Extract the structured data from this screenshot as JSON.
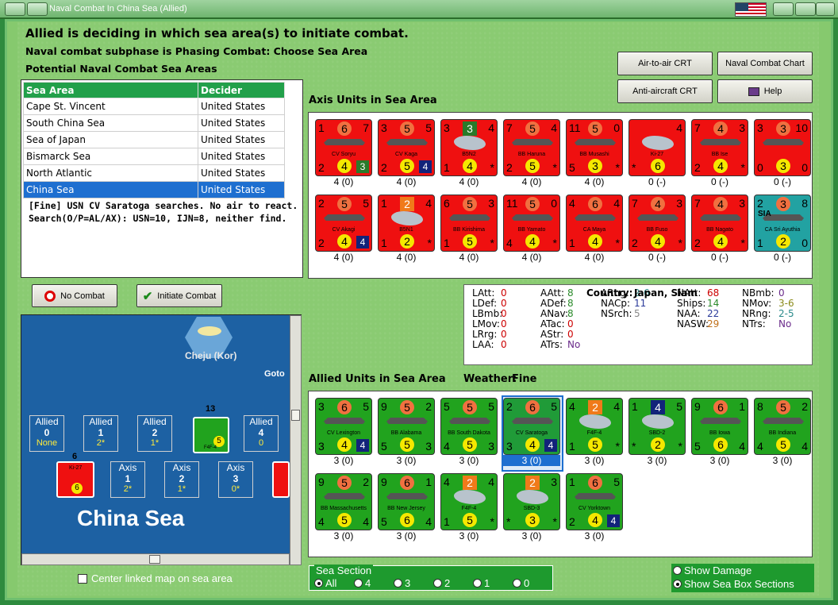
{
  "window": {
    "title": "Naval Combat In China Sea (Allied)"
  },
  "header": {
    "line1": "Allied is deciding in which sea area(s) to initiate combat.",
    "line2": "Naval combat subphase is Phasing Combat: Choose Sea Area",
    "line3": "Potential Naval Combat Sea Areas"
  },
  "buttons": {
    "air_to_air": "Air-to-air CRT",
    "naval_chart": "Naval Combat Chart",
    "anti_aircraft": "Anti-aircraft CRT",
    "help": "Help",
    "no_combat": "No Combat",
    "initiate": "Initiate Combat"
  },
  "sea_table": {
    "headers": [
      "Sea Area",
      "Decider"
    ],
    "rows": [
      [
        "Cape St. Vincent",
        "United States"
      ],
      [
        "South China Sea",
        "United States"
      ],
      [
        "Sea of Japan",
        "United States"
      ],
      [
        "Bismarck Sea",
        "United States"
      ],
      [
        "North Atlantic",
        "United States"
      ],
      [
        "China Sea",
        "United States"
      ]
    ],
    "selected": 5
  },
  "log": "[Fine]  USN CV Saratoga searches.  No air to react.  Search(O/P=AL/AX):  USN=10, IJN=8, neither find.",
  "axis": {
    "title": "Axis Units in Sea Area",
    "units": [
      {
        "tl": "1",
        "tc": "6",
        "tr": "7",
        "name": "CV Soryu",
        "bl": "2",
        "bc": "4",
        "br": "3",
        "cap": "4 (0)",
        "kind": "ship",
        "brstyle": "g"
      },
      {
        "tl": "3",
        "tc": "5",
        "tr": "5",
        "name": "CV Kaga",
        "bl": "2",
        "bc": "5",
        "br": "4",
        "cap": "4 (0)",
        "kind": "ship",
        "brstyle": "b"
      },
      {
        "tl": "3",
        "tc": "3",
        "tr": "4",
        "name": "B5N2",
        "bl": "1",
        "bc": "4",
        "br": "*",
        "cap": "4 (0)",
        "kind": "plane",
        "tcstyle": "g"
      },
      {
        "tl": "7",
        "tc": "5",
        "tr": "4",
        "name": "BB Haruna",
        "bl": "2",
        "bc": "5",
        "br": "*",
        "cap": "4 (0)",
        "kind": "ship"
      },
      {
        "tl": "11",
        "tc": "5",
        "tr": "0",
        "name": "BB Musashi",
        "bl": "5",
        "bc": "3",
        "br": "*",
        "cap": "4 (0)",
        "kind": "ship"
      },
      {
        "tl": "",
        "tc": "",
        "tr": "4",
        "name": "Ki-27",
        "bl": "*",
        "bc": "6",
        "br": "",
        "cap": "0 (-)",
        "kind": "plane"
      },
      {
        "tl": "7",
        "tc": "4",
        "tr": "3",
        "name": "BB Ise",
        "bl": "2",
        "bc": "4",
        "br": "*",
        "cap": "0 (-)",
        "kind": "ship"
      },
      {
        "tl": "3",
        "tc": "3",
        "tr": "10",
        "name": "",
        "bl": "0",
        "bc": "3",
        "br": "0",
        "cap": "0 (-)",
        "kind": "ship"
      },
      {
        "tl": "2",
        "tc": "5",
        "tr": "5",
        "name": "CV Akagi",
        "bl": "2",
        "bc": "4",
        "br": "4",
        "cap": "4 (0)",
        "kind": "ship",
        "brstyle": "b"
      },
      {
        "tl": "1",
        "tc": "2",
        "tr": "4",
        "name": "B5N1",
        "bl": "1",
        "bc": "2",
        "br": "*",
        "cap": "4 (0)",
        "kind": "plane",
        "tcstyle": "o"
      },
      {
        "tl": "6",
        "tc": "5",
        "tr": "3",
        "name": "BB Kirishima",
        "bl": "1",
        "bc": "5",
        "br": "*",
        "cap": "4 (0)",
        "kind": "ship"
      },
      {
        "tl": "11",
        "tc": "5",
        "tr": "0",
        "name": "BB Yamato",
        "bl": "4",
        "bc": "4",
        "br": "*",
        "cap": "4 (0)",
        "kind": "ship"
      },
      {
        "tl": "4",
        "tc": "6",
        "tr": "4",
        "name": "CA Maya",
        "bl": "1",
        "bc": "4",
        "br": "*",
        "cap": "4 (0)",
        "kind": "ship"
      },
      {
        "tl": "7",
        "tc": "4",
        "tr": "3",
        "name": "BB Fuso",
        "bl": "2",
        "bc": "4",
        "br": "*",
        "cap": "0 (-)",
        "kind": "ship"
      },
      {
        "tl": "7",
        "tc": "4",
        "tr": "3",
        "name": "BB Nagato",
        "bl": "2",
        "bc": "4",
        "br": "*",
        "cap": "0 (-)",
        "kind": "ship"
      },
      {
        "tl": "2",
        "tc": "3",
        "tr": "8",
        "name": "CA Sri Ayuthia",
        "bl": "1",
        "bc": "2",
        "br": "0",
        "cap": "0 (-)",
        "kind": "ship",
        "color": "teal",
        "tag": "SIA"
      }
    ]
  },
  "stats": {
    "country_label": "Country:",
    "country_value": "Japan, Siam",
    "col1": [
      [
        "LAtt:",
        "0"
      ],
      [
        "LDef:",
        "0"
      ],
      [
        "LBmb:",
        "0"
      ],
      [
        "LMov:",
        "0"
      ],
      [
        "LRrg:",
        "0"
      ],
      [
        "LAA:",
        "0"
      ]
    ],
    "col2": [
      [
        "AAtt:",
        "8"
      ],
      [
        "ADef:",
        "8"
      ],
      [
        "ANav:",
        "8"
      ],
      [
        "ATac:",
        "0"
      ],
      [
        "AStr:",
        "0"
      ],
      [
        "ATrs:",
        "No"
      ]
    ],
    "col3": [
      [
        "ARng:",
        "2-6"
      ],
      [
        "NACp:",
        "11"
      ],
      [
        "NSrch:",
        "5"
      ]
    ],
    "col4": [
      [
        "NAtt:",
        "68"
      ],
      [
        "Ships:",
        "14"
      ],
      [
        "NAA:",
        "22"
      ],
      [
        "NASW:",
        "29"
      ]
    ],
    "col5": [
      [
        "NBmb:",
        "0"
      ],
      [
        "NMov:",
        "3-6"
      ],
      [
        "NRng:",
        "2-5"
      ],
      [
        "NTrs:",
        "No"
      ]
    ]
  },
  "allied": {
    "title": "Allied Units in Sea Area",
    "weather_label": "Weather:",
    "weather": "Fine",
    "units": [
      {
        "tl": "3",
        "tc": "6",
        "tr": "5",
        "name": "CV Lexington",
        "bl": "3",
        "bc": "4",
        "br": "4",
        "cap": "3 (0)",
        "kind": "ship",
        "brstyle": "b"
      },
      {
        "tl": "9",
        "tc": "5",
        "tr": "2",
        "name": "BB Alabama",
        "bl": "5",
        "bc": "5",
        "br": "3",
        "cap": "3 (0)",
        "kind": "ship"
      },
      {
        "tl": "5",
        "tc": "5",
        "tr": "5",
        "name": "BB South Dakota",
        "bl": "4",
        "bc": "5",
        "br": "3",
        "cap": "3 (0)",
        "kind": "ship"
      },
      {
        "tl": "2",
        "tc": "6",
        "tr": "5",
        "name": "CV Saratoga",
        "bl": "3",
        "bc": "4",
        "br": "4",
        "cap": "3 (0)",
        "kind": "ship",
        "brstyle": "b",
        "sel": true
      },
      {
        "tl": "4",
        "tc": "2",
        "tr": "4",
        "name": "F4F-4",
        "bl": "1",
        "bc": "5",
        "br": "*",
        "cap": "3 (0)",
        "kind": "plane",
        "tcstyle": "o"
      },
      {
        "tl": "1",
        "tc": "4",
        "tr": "5",
        "name": "SBD-2",
        "bl": "*",
        "bc": "2",
        "br": "*",
        "cap": "3 (0)",
        "kind": "plane",
        "tcstyle": "n"
      },
      {
        "tl": "9",
        "tc": "6",
        "tr": "1",
        "name": "BB Iowa",
        "bl": "5",
        "bc": "6",
        "br": "4",
        "cap": "3 (0)",
        "kind": "ship"
      },
      {
        "tl": "8",
        "tc": "5",
        "tr": "2",
        "name": "BB Indiana",
        "bl": "4",
        "bc": "5",
        "br": "4",
        "cap": "3 (0)",
        "kind": "ship"
      },
      {
        "tl": "9",
        "tc": "5",
        "tr": "2",
        "name": "BB Massachusetts",
        "bl": "4",
        "bc": "5",
        "br": "4",
        "cap": "3 (0)",
        "kind": "ship"
      },
      {
        "tl": "9",
        "tc": "6",
        "tr": "1",
        "name": "BB New Jersey",
        "bl": "5",
        "bc": "6",
        "br": "4",
        "cap": "3 (0)",
        "kind": "ship"
      },
      {
        "tl": "4",
        "tc": "2",
        "tr": "4",
        "name": "F4F-4",
        "bl": "1",
        "bc": "5",
        "br": "*",
        "cap": "3 (0)",
        "kind": "plane",
        "tcstyle": "o"
      },
      {
        "tl": "",
        "tc": "2",
        "tr": "3",
        "name": "SBD-3",
        "bl": "*",
        "bc": "3",
        "br": "*",
        "cap": "3 (0)",
        "kind": "plane",
        "tcstyle": "o"
      },
      {
        "tl": "1",
        "tc": "6",
        "tr": "5",
        "name": "CV Yorktown",
        "bl": "2",
        "bc": "4",
        "br": "4",
        "cap": "3 (0)",
        "kind": "ship",
        "brstyle": "b"
      }
    ]
  },
  "map": {
    "hex_label": "Cheju (Kor)",
    "goto_label": "Goto",
    "sea_name": "China Sea",
    "allied_boxes": [
      {
        "label": "Allied",
        "num": "0",
        "sub": "None"
      },
      {
        "label": "Allied",
        "num": "1",
        "sub": "2*"
      },
      {
        "label": "Allied",
        "num": "2",
        "sub": "1*"
      },
      {
        "label": "Allied",
        "num": "4",
        "sub": "0"
      }
    ],
    "axis_boxes": [
      {
        "label": "Axis",
        "num": "1",
        "sub": "2*"
      },
      {
        "label": "Axis",
        "num": "2",
        "sub": "1*"
      },
      {
        "label": "Axis",
        "num": "3",
        "sub": "0*"
      }
    ],
    "stack1": "13",
    "stack2": "6",
    "counter_name": "F4F-4",
    "counter_val": "5",
    "counter2_name": "Ki-27",
    "counter2_val": "6"
  },
  "center_linked": "Center linked map on sea area",
  "sea_section": {
    "label": "Sea Section",
    "options": [
      "All",
      "4",
      "3",
      "2",
      "1",
      "0"
    ],
    "selected": "All"
  },
  "display": {
    "show_damage": "Show Damage",
    "show_sea_box": "Show Sea Box Sections",
    "selected": "show_sea_box"
  }
}
